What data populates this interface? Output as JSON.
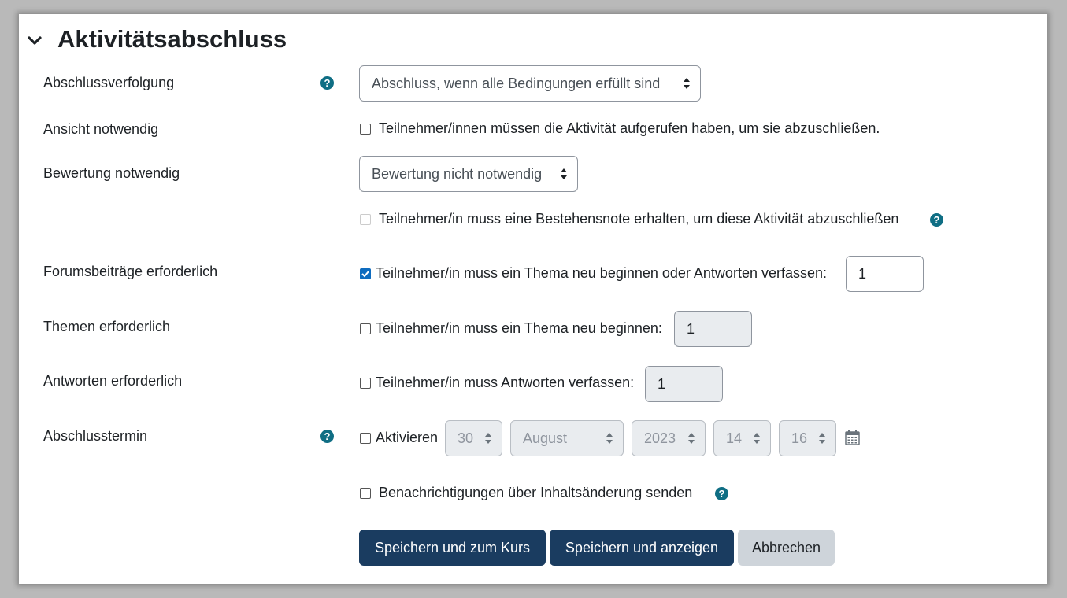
{
  "section": {
    "title": "Aktivitätsabschluss"
  },
  "rows": {
    "tracking": {
      "label": "Abschlussverfolgung",
      "value": "Abschluss, wenn alle Bedingungen erfüllt sind"
    },
    "view": {
      "label": "Ansicht notwendig",
      "checkbox_label": "Teilnehmer/innen müssen die Aktivität aufgerufen haben, um sie abzuschließen.",
      "checked": false
    },
    "grade": {
      "label": "Bewertung notwendig",
      "value": "Bewertung nicht notwendig"
    },
    "passgrade": {
      "checkbox_label": "Teilnehmer/in muss eine Bestehensnote erhalten, um diese Aktivität abzuschließen",
      "checked": false,
      "disabled": true
    },
    "posts": {
      "label": "Forumsbeiträge erforderlich",
      "checkbox_label": "Teilnehmer/in muss ein Thema neu beginnen oder Antworten verfassen:",
      "checked": true,
      "value": "1"
    },
    "discussions": {
      "label": "Themen erforderlich",
      "checkbox_label": "Teilnehmer/in muss ein Thema neu beginnen:",
      "checked": false,
      "value": "1"
    },
    "replies": {
      "label": "Antworten erforderlich",
      "checkbox_label": "Teilnehmer/in muss Antworten verfassen:",
      "checked": false,
      "value": "1"
    },
    "expected": {
      "label": "Abschlusstermin",
      "checkbox_label": "Aktivieren",
      "checked": false,
      "day": "30",
      "month": "August",
      "year": "2023",
      "hour": "14",
      "minute": "16"
    },
    "notify": {
      "checkbox_label": "Benachrichtigungen über Inhaltsänderung senden",
      "checked": false
    }
  },
  "buttons": {
    "save_return": "Speichern und zum Kurs",
    "save_display": "Speichern und anzeigen",
    "cancel": "Abbrechen"
  },
  "icons": {
    "help": "question-circle-icon",
    "calendar": "calendar-icon",
    "collapse": "chevron-down-icon"
  },
  "colors": {
    "primary": "#1a3c60",
    "help": "#0f6e84",
    "checkbox_checked": "#0f6cbf"
  }
}
